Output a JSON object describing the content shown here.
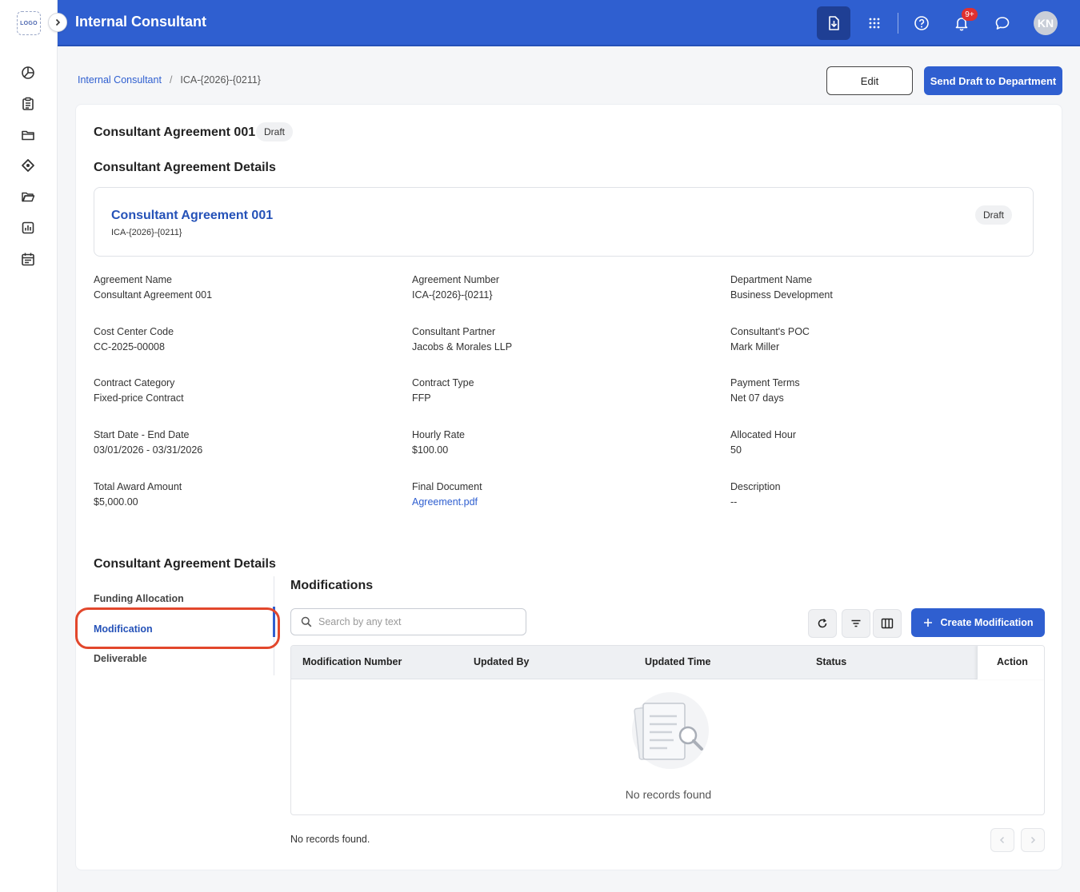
{
  "app": {
    "logo_text": "LOGO",
    "title": "Internal Consultant",
    "notification_badge": "9+",
    "avatar_initials": "KN"
  },
  "rail": {
    "icons": [
      "dashboard-icon",
      "clipboard-icon",
      "folder-icon",
      "tag-icon",
      "folder-open-icon",
      "report-chart-icon",
      "calendar-icon"
    ]
  },
  "breadcrumb": {
    "root": "Internal Consultant",
    "separator": "/",
    "current": "ICA-{2026}-{0211}"
  },
  "actions": {
    "edit_label": "Edit",
    "send_label": "Send Draft to Department"
  },
  "agreement": {
    "title": "Consultant Agreement 001",
    "status": "Draft",
    "details_heading": "Consultant Agreement Details",
    "summary_name": "Consultant Agreement 001",
    "summary_number": "ICA-{2026}-{0211}",
    "summary_status": "Draft"
  },
  "fields": [
    {
      "label": "Agreement Name",
      "value": "Consultant Agreement 001"
    },
    {
      "label": "Agreement Number",
      "value": "ICA-{2026}-{0211}"
    },
    {
      "label": "Department Name",
      "value": "Business Development"
    },
    {
      "label": "Cost Center Code",
      "value": "CC-2025-00008"
    },
    {
      "label": "Consultant Partner",
      "value": "Jacobs & Morales LLP"
    },
    {
      "label": "Consultant's POC",
      "value": "Mark Miller"
    },
    {
      "label": "Contract Category",
      "value": "Fixed-price Contract"
    },
    {
      "label": "Contract Type",
      "value": "FFP"
    },
    {
      "label": "Payment Terms",
      "value": "Net 07 days"
    },
    {
      "label": "Start Date - End Date",
      "value": "03/01/2026 - 03/31/2026"
    },
    {
      "label": "Hourly Rate",
      "value": "$100.00"
    },
    {
      "label": "Allocated Hour",
      "value": "50"
    },
    {
      "label": "Total Award Amount",
      "value": "$5,000.00"
    },
    {
      "label": "Final Document",
      "value": "Agreement.pdf"
    },
    {
      "label": "Description",
      "value": "--"
    }
  ],
  "lower": {
    "heading": "Consultant Agreement Details",
    "tabs": [
      "Funding Allocation",
      "Modification",
      "Deliverable"
    ],
    "active_tab": "Modification"
  },
  "modifications": {
    "title": "Modifications",
    "search_placeholder": "Search by any text",
    "create_label": "Create Modification",
    "columns": [
      "Modification Number",
      "Updated By",
      "Updated Time",
      "Status",
      "Action"
    ],
    "rows": [],
    "empty_text": "No records found",
    "footer_text": "No records found."
  },
  "colors": {
    "primary": "#2f5fd0",
    "highlight": "#e2472c",
    "badge": "#e03030"
  }
}
